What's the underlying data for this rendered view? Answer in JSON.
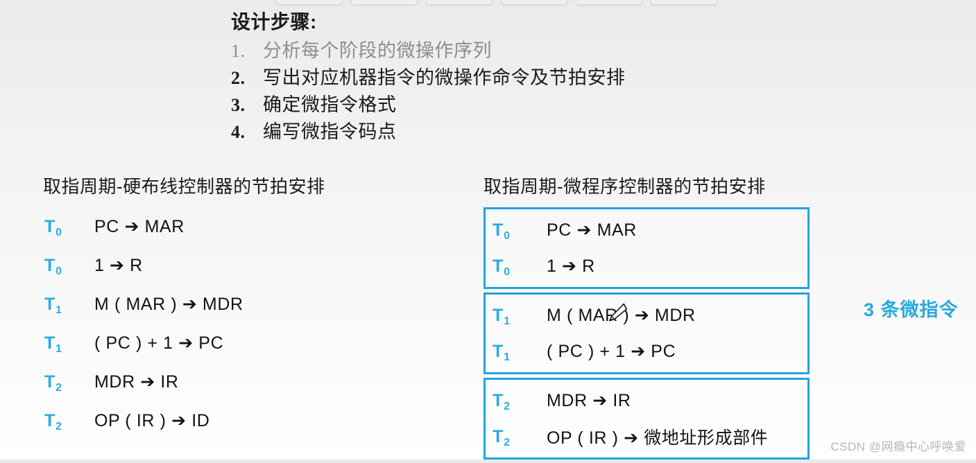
{
  "toolbar": {
    "buttons": [
      "",
      "",
      "",
      "",
      "",
      ""
    ]
  },
  "design_steps": {
    "title": "设计步骤:",
    "items": [
      {
        "num": "1.",
        "text": "分析每个阶段的微操作序列",
        "dim": true
      },
      {
        "num": "2.",
        "text": "写出对应机器指令的微操作命令及节拍安排",
        "dim": false
      },
      {
        "num": "3.",
        "text": "确定微指令格式",
        "dim": false
      },
      {
        "num": "4.",
        "text": "编写微指令码点",
        "dim": false
      }
    ]
  },
  "left_column": {
    "heading": "取指周期-硬布线控制器的节拍安排",
    "rows": [
      {
        "t": "T",
        "sub": "0",
        "op": "PC ➔ MAR"
      },
      {
        "t": "T",
        "sub": "0",
        "op": "1 ➔ R"
      },
      {
        "t": "T",
        "sub": "1",
        "op": "M ( MAR ) ➔ MDR"
      },
      {
        "t": "T",
        "sub": "1",
        "op": "( PC ) + 1 ➔ PC"
      },
      {
        "t": "T",
        "sub": "2",
        "op": "MDR ➔ IR"
      },
      {
        "t": "T",
        "sub": "2",
        "op": "OP ( IR ) ➔ ID"
      }
    ]
  },
  "right_column": {
    "heading": "取指周期-微程序控制器的节拍安排",
    "boxes": [
      {
        "rows": [
          {
            "t": "T",
            "sub": "0",
            "op": "PC ➔ MAR"
          },
          {
            "t": "T",
            "sub": "0",
            "op": "1 ➔ R"
          }
        ]
      },
      {
        "rows": [
          {
            "t": "T",
            "sub": "1",
            "op": "M ( MAR ) ➔ MDR"
          },
          {
            "t": "T",
            "sub": "1",
            "op": "( PC ) + 1 ➔ PC"
          }
        ]
      },
      {
        "rows": [
          {
            "t": "T",
            "sub": "2",
            "op": "MDR ➔ IR"
          },
          {
            "t": "T",
            "sub": "2",
            "op": "OP ( IR ) ➔ 微地址形成部件"
          }
        ]
      }
    ]
  },
  "annotation": {
    "micro_instruction_count": "3 条微指令"
  },
  "watermark": {
    "text": "CSDN @网瘾中心呼唤爱"
  },
  "colors": {
    "accent_cyan": "#29abe2",
    "box_border": "#23a3e0",
    "text_primary": "#121212",
    "text_dim": "#8d8d8d",
    "watermark": "#b6b6b6"
  }
}
